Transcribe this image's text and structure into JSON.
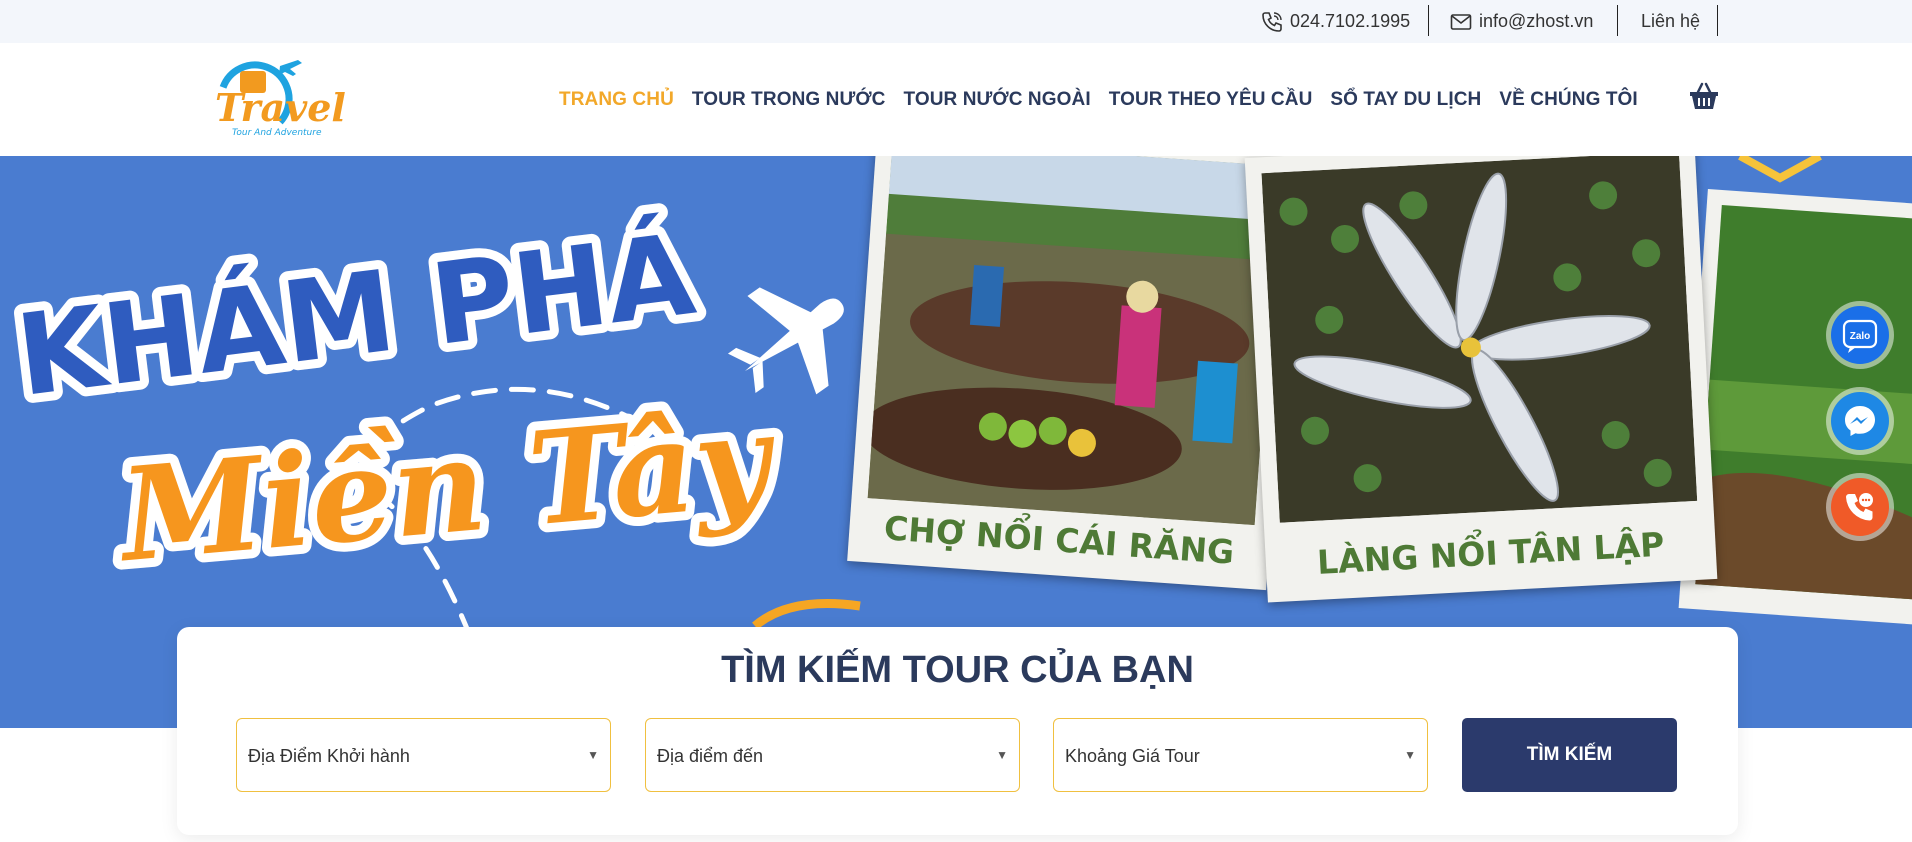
{
  "topbar": {
    "phone": "024.7102.1995",
    "email": "info@zhost.vn",
    "contact": "Liên hệ"
  },
  "logo": {
    "main": "Travel",
    "tagline": "Tour And Adventure"
  },
  "nav": [
    {
      "label": "TRANG CHỦ",
      "active": true
    },
    {
      "label": "TOUR TRONG NƯỚC",
      "active": false
    },
    {
      "label": "TOUR NƯỚC NGOÀI",
      "active": false
    },
    {
      "label": "TOUR THEO YÊU CẦU",
      "active": false
    },
    {
      "label": "SỔ TAY DU LỊCH",
      "active": false
    },
    {
      "label": "VỀ CHÚNG TÔI",
      "active": false
    }
  ],
  "hero": {
    "title_line1": "KHÁM PHÁ",
    "title_line2": "Miền Tây",
    "photo1_caption": "CHỢ NỔI CÁI RĂNG",
    "photo2_caption": "LÀNG NỔI TÂN LẬP"
  },
  "floating": {
    "zalo": "Zalo"
  },
  "search": {
    "title": "TÌM KIẾM TOUR CỦA BẠN",
    "departure": "Địa Điểm Khởi hành",
    "destination": "Địa điểm đến",
    "price": "Khoảng Giá Tour",
    "button": "TÌM KIẾM"
  },
  "colors": {
    "brand_navy": "#2b3a5c",
    "accent_orange": "#f2a82a",
    "hero_blue": "#4a7cd0",
    "caption_green": "#4e7a35"
  }
}
